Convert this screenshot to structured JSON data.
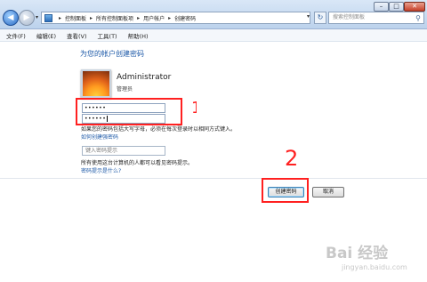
{
  "window": {
    "breadcrumbs": [
      "控制面板",
      "所有控制面板项",
      "用户帐户",
      "创建密码"
    ],
    "search_placeholder": "搜索控制面板"
  },
  "menu": [
    "文件(F)",
    "编辑(E)",
    "查看(V)",
    "工具(T)",
    "帮助(H)"
  ],
  "content": {
    "title": "为您的帐户创建密码",
    "user_name": "Administrator",
    "user_role": "管理员",
    "password_value": "••••••",
    "confirm_value": "••••••",
    "case_note": "如果您的密码包括大写字母，必须在每次登录时以相同方式键入。",
    "strong_password_link": "如何创建强密码",
    "hint_placeholder": "键入密码提示",
    "hint_note": "所有使用这台计算机的人都可以看见密码提示。",
    "hint_link": "密码提示是什么?"
  },
  "buttons": {
    "create": "创建密码",
    "cancel": "取消"
  },
  "annotations": {
    "step1": "1",
    "step2": "2"
  },
  "watermark": {
    "brand": "Bai 经验",
    "url": "jingyan.baidu.com"
  },
  "colors": {
    "annotation_red": "#ff2020",
    "link_blue": "#1e5aa8"
  },
  "icons": {
    "back": "back-arrow-icon",
    "forward": "forward-arrow-icon",
    "refresh": "refresh-icon",
    "search": "search-icon",
    "control_panel": "control-panel-icon"
  }
}
